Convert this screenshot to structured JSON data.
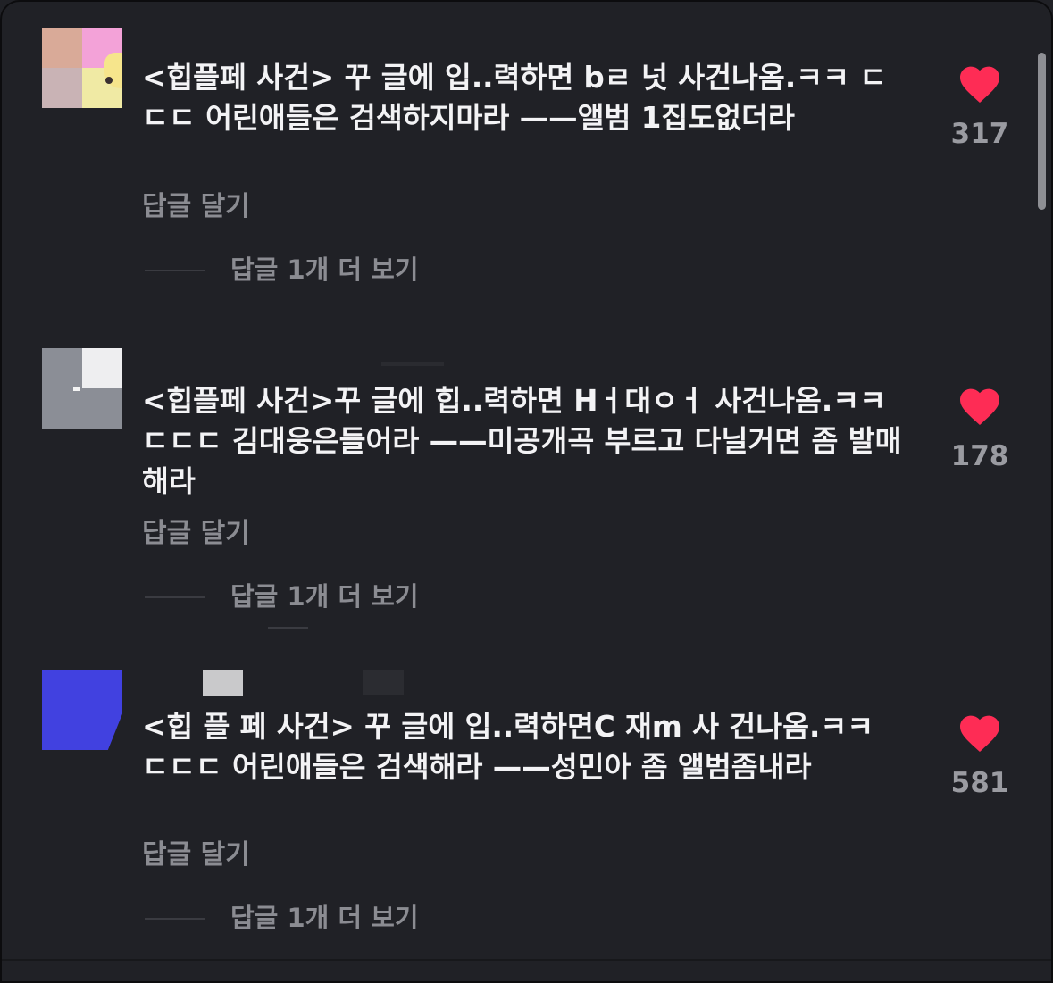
{
  "comments": [
    {
      "text": "<힙플페 사건> 꾸 글에 입..력하면 bㄹ 넛 사건나옴.ㅋㅋ ㄷㄷㄷ 어린애들은 검색하지마라 ——앨범 1집도없더라",
      "reply_label": "답글 달기",
      "more_replies_label": "답글 1개 더 보기",
      "likes": "317"
    },
    {
      "text": "<힙플페 사건>꾸 글에 힙..력하면 Hㅓ대ㅇㅓ 사건나옴.ㅋㅋ ㄷㄷㄷ 김대웅은들어라 ——미공개곡 부르고 다닐거면 좀 발매해라",
      "reply_label": "답글 달기",
      "more_replies_label": "답글 1개 더 보기",
      "likes": "178"
    },
    {
      "text": "<힙 플 페 사건> 꾸 글에 입..력하면C 재m 사 건나옴.ㅋㅋ  ㄷㄷㄷ 어린애들은 검색해라 ——성민아 좀 앨범좀내라",
      "reply_label": "답글 달기",
      "more_replies_label": "답글 1개 더 보기",
      "likes": "581"
    }
  ],
  "colors": {
    "background": "#202126",
    "heart": "#fe2c55",
    "secondary_text": "#8b8c92"
  },
  "icons": {
    "like": "heart-icon"
  }
}
